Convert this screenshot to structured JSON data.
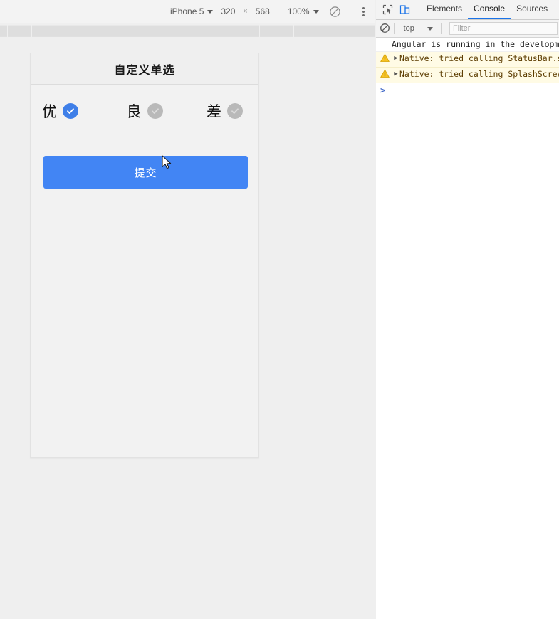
{
  "device_toolbar": {
    "device_name": "iPhone 5",
    "width": "320",
    "height": "568",
    "times_symbol": "×",
    "zoom": "100%",
    "rotate_icon": "rotate-disabled-icon",
    "menu_icon": "kebab-menu-icon"
  },
  "app": {
    "card_title": "自定义单选",
    "options": [
      {
        "label": "优",
        "selected": true
      },
      {
        "label": "良",
        "selected": false
      },
      {
        "label": "差",
        "selected": false
      }
    ],
    "submit_label": "提交"
  },
  "devtools": {
    "inspect_icon": "inspect-element-icon",
    "device_toggle_icon": "device-toolbar-icon",
    "tabs": [
      {
        "label": "Elements",
        "active": false
      },
      {
        "label": "Console",
        "active": true
      },
      {
        "label": "Sources",
        "active": false
      }
    ],
    "clear_icon": "clear-console-icon",
    "context": "top",
    "filter_placeholder": "Filter",
    "filter_value": "",
    "messages": [
      {
        "level": "info",
        "text": "Angular is running in the developme",
        "expandable": false
      },
      {
        "level": "warning",
        "text": "Native: tried calling StatusBar.st",
        "expandable": true
      },
      {
        "level": "warning",
        "text": "Native: tried calling SplashScreen",
        "expandable": true
      }
    ],
    "prompt": ">"
  },
  "colors": {
    "accent_blue": "#4285f4",
    "radio_on": "#3f7fe8",
    "radio_off": "#b9b9b9",
    "page_bg": "#efefef",
    "warn_bg": "#fffbe5",
    "tab_active_underline": "#1a73e8"
  }
}
